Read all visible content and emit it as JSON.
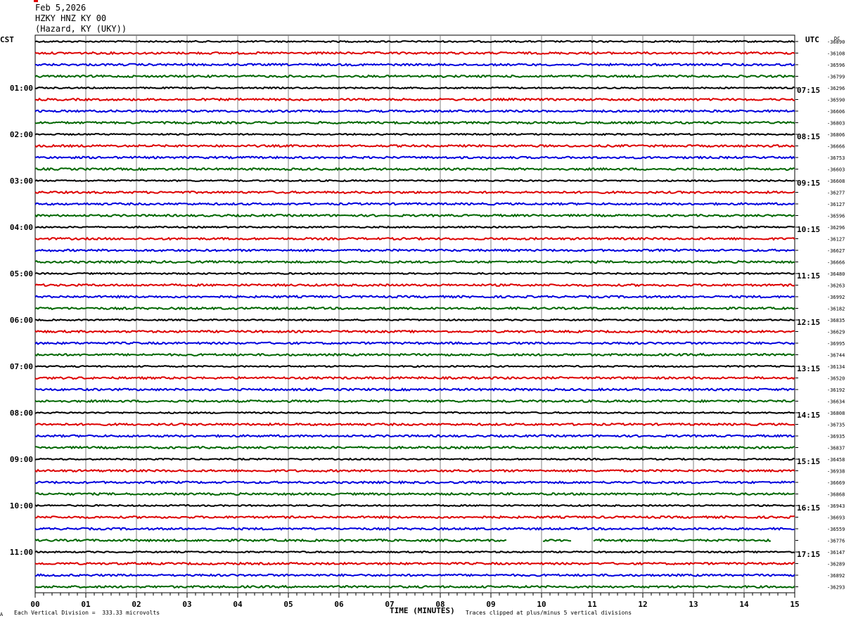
{
  "header": {
    "date": "Feb 5,2026",
    "station": "HZKY HNZ KY 00",
    "location": "(Hazard, KY (UKY))"
  },
  "left_axis_title": "CST",
  "right_axis_title": "UTC",
  "right_top_label": "DC",
  "footer": {
    "left": "Each Vertical Division =  333.33 microvolts",
    "center": "TIME (MINUTES)",
    "right": "Traces clipped at plus/minus 5 vertical divisions",
    "mark": "A"
  },
  "colors": {
    "cycle": [
      "#000000",
      "#dd0000",
      "#0000dd",
      "#006600"
    ],
    "grid": "#808080"
  },
  "chart_data": {
    "type": "line",
    "xlabel": "TIME (MINUTES)",
    "xlim": [
      0,
      15
    ],
    "x_ticks": [
      "00",
      "01",
      "02",
      "03",
      "04",
      "05",
      "06",
      "07",
      "08",
      "09",
      "10",
      "11",
      "12",
      "13",
      "14",
      "15"
    ],
    "hour_labels_cst": [
      "01:00",
      "02:00",
      "03:00",
      "04:00",
      "05:00",
      "06:00",
      "07:00",
      "08:00",
      "09:00",
      "10:00",
      "11:00"
    ],
    "hour_labels_utc": [
      "07:15",
      "08:15",
      "09:15",
      "10:15",
      "11:15",
      "12:15",
      "13:15",
      "14:15",
      "15:15",
      "16:15",
      "17:15"
    ],
    "trace_count": 48,
    "dc_offsets": [
      "-36890",
      "-36108",
      "-36596",
      "-36799",
      "-36296",
      "-36590",
      "-36606",
      "-36803",
      "-36806",
      "-36666",
      "-36753",
      "-36603",
      "-36608",
      "-36277",
      "-36127",
      "-36596",
      "-36296",
      "-36127",
      "-36627",
      "-36666",
      "-36480",
      "-36263",
      "-36992",
      "-36182",
      "-36835",
      "-36629",
      "-36995",
      "-36744",
      "-36134",
      "-36520",
      "-36192",
      "-36634",
      "-36808",
      "-36735",
      "-36935",
      "-36837",
      "-36458",
      "-36938",
      "-36669",
      "-36868",
      "-36943",
      "-36693",
      "-36559",
      "-36776",
      "-36147",
      "-36289",
      "-36892",
      "-36293"
    ],
    "gaps": [
      {
        "trace": 43,
        "from_minute": 9.32,
        "to_minute": 10.02
      },
      {
        "trace": 43,
        "from_minute": 10.6,
        "to_minute": 11.0
      },
      {
        "trace": 43,
        "from_minute": 14.55,
        "to_minute": 15.0
      }
    ]
  }
}
